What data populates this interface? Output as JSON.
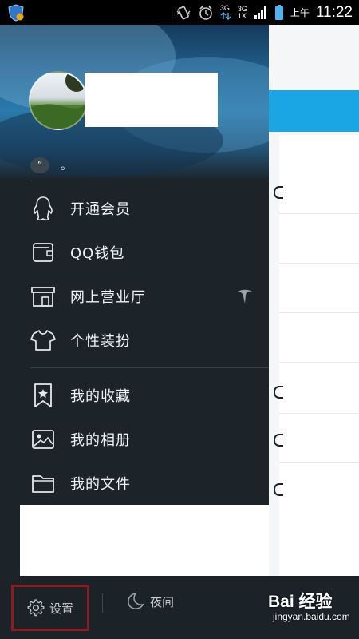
{
  "status_bar": {
    "network_1": "3G",
    "network_2_top": "3G",
    "network_2_sub": "1X",
    "ampm": "上午",
    "time": "11:22"
  },
  "drawer": {
    "signature": "。",
    "menu_group_1": [
      {
        "label": "开通会员",
        "icon": "qq-penguin-icon"
      },
      {
        "label": "QQ钱包",
        "icon": "wallet-icon"
      },
      {
        "label": "网上营业厅",
        "icon": "store-icon"
      },
      {
        "label": "个性装扮",
        "icon": "tshirt-icon"
      }
    ],
    "menu_group_2": [
      {
        "label": "我的收藏",
        "icon": "bookmark-star-icon"
      },
      {
        "label": "我的相册",
        "icon": "photo-album-icon"
      },
      {
        "label": "我的文件",
        "icon": "folder-icon"
      }
    ]
  },
  "bottom_bar": {
    "settings_label": "设置",
    "night_label": "夜间"
  },
  "watermark": {
    "main": "Bai 经验",
    "sub": "jingyan.baidu.com"
  },
  "colors": {
    "drawer_bg": "#1c2329",
    "accent_blue": "#1aa6e4",
    "highlight_border": "#8a1d24"
  }
}
